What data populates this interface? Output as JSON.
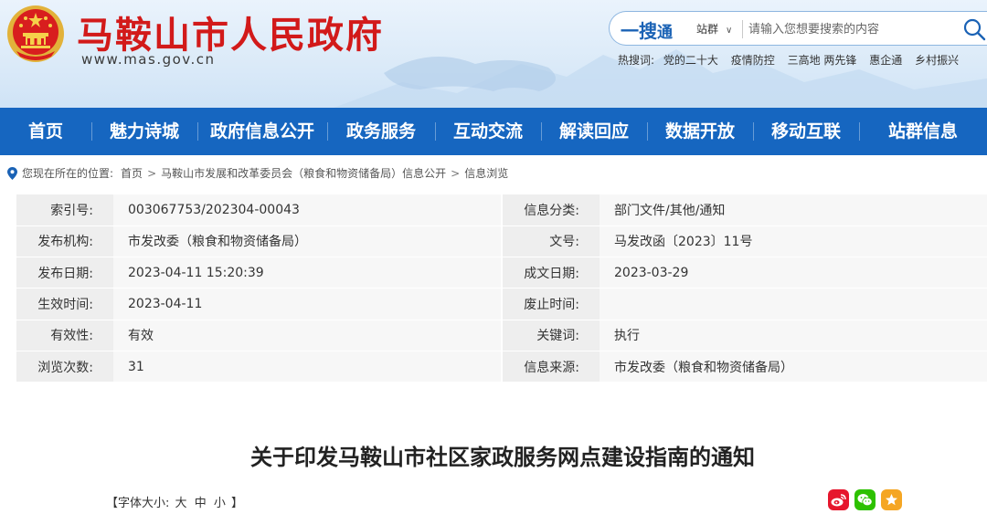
{
  "header": {
    "site_title": "马鞍山市人民政府",
    "site_url": "www.mas.gov.cn",
    "search": {
      "brand_main": "一搜",
      "brand_sub": "通",
      "scope": "站群",
      "placeholder": "请输入您想要搜索的内容"
    },
    "hot": {
      "label": "热搜词:",
      "items": [
        "党的二十大",
        "疫情防控",
        "三高地 两先锋",
        "惠企通",
        "乡村振兴"
      ]
    }
  },
  "nav": {
    "items": [
      "首页",
      "魅力诗城",
      "政府信息公开",
      "政务服务",
      "互动交流",
      "解读回应",
      "数据开放",
      "移动互联",
      "站群信息"
    ]
  },
  "breadcrumb": {
    "label": "您现在所在的位置:",
    "items": [
      "首页",
      "马鞍山市发展和改革委员会（粮食和物资储备局）信息公开",
      "信息浏览"
    ]
  },
  "info": {
    "rows": [
      {
        "k1": "索引号:",
        "v1": "003067753/202304-00043",
        "k2": "信息分类:",
        "v2": "部门文件/其他/通知"
      },
      {
        "k1": "发布机构:",
        "v1": "市发改委（粮食和物资储备局）",
        "k2": "文号:",
        "v2": "马发改函〔2023〕11号"
      },
      {
        "k1": "发布日期:",
        "v1": "2023-04-11 15:20:39",
        "k2": "成文日期:",
        "v2": "2023-03-29"
      },
      {
        "k1": "生效时间:",
        "v1": "2023-04-11",
        "k2": "废止时间:",
        "v2": ""
      },
      {
        "k1": "有效性:",
        "v1": "有效",
        "k2": "关键词:",
        "v2": "执行"
      },
      {
        "k1": "浏览次数:",
        "v1": "31",
        "k2": "信息来源:",
        "v2": "市发改委（粮食和物资储备局）"
      }
    ]
  },
  "article": {
    "title": "关于印发马鞍山市社区家政服务网点建设指南的通知",
    "font_size_open": "【字体大小:",
    "font_large": "大",
    "font_medium": "中",
    "font_small": "小",
    "font_size_close": "】"
  },
  "colors": {
    "nav_bg": "#1666c0",
    "title_red": "#d21a1a",
    "weibo": "#e6162d",
    "wechat": "#2dc100",
    "favorite": "#f5a623"
  }
}
